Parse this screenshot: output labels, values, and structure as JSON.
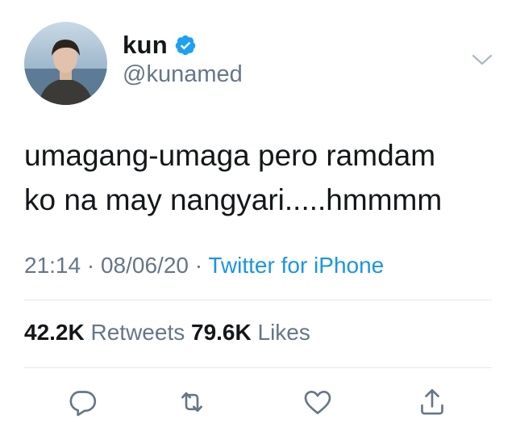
{
  "user": {
    "display_name": "kun",
    "handle": "@kunamed",
    "verified": true
  },
  "tweet": {
    "text_line1": "umagang-umaga pero ramdam",
    "text_line2": "ko na may nangyari.....hmmmm",
    "time": "21:14",
    "date": "08/06/20",
    "separator": "·",
    "source": "Twitter for iPhone"
  },
  "stats": {
    "retweets_count": "42.2K",
    "retweets_label": "Retweets",
    "likes_count": "79.6K",
    "likes_label": "Likes"
  },
  "icons": {
    "verified": "verified-badge-icon",
    "menu": "chevron-down-icon",
    "reply": "reply-icon",
    "retweet": "retweet-icon",
    "like": "heart-icon",
    "share": "share-icon"
  },
  "colors": {
    "text": "#14171a",
    "secondary": "#657786",
    "link": "#1b95e0",
    "verified": "#1da1f2",
    "divider": "#e1e8ed"
  }
}
